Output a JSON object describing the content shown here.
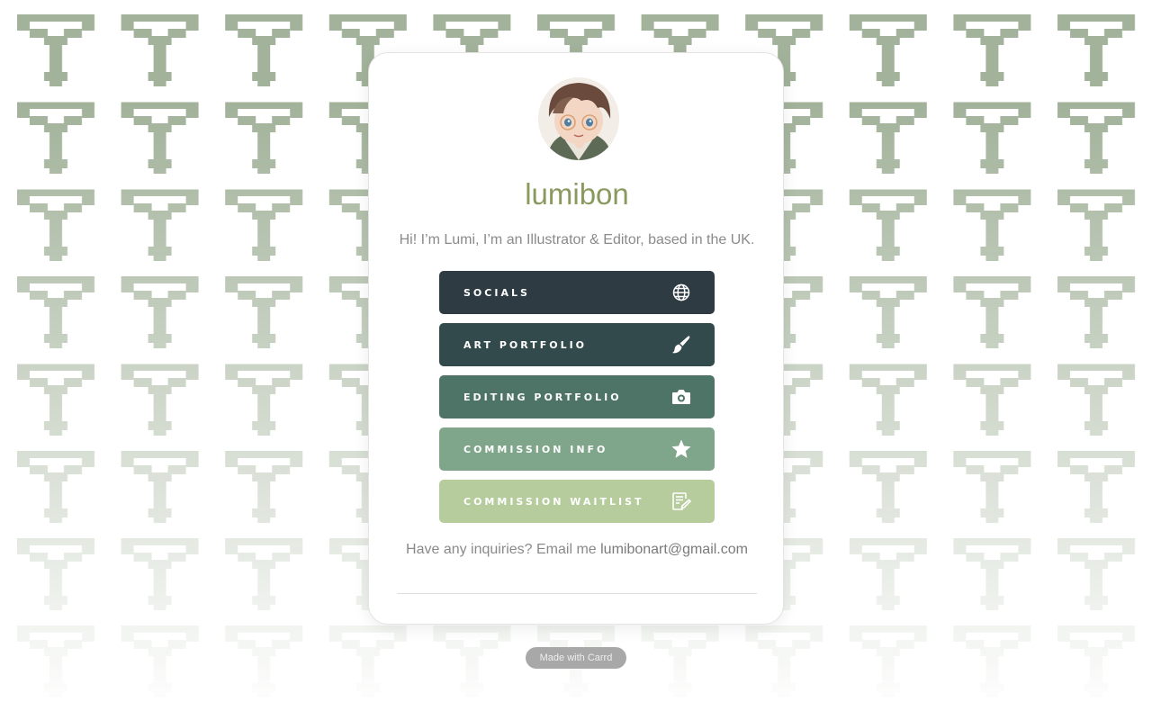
{
  "profile": {
    "name": "lumibon",
    "bio": "Hi! I’m Lumi, I’m an Illustrator & Editor, based in the UK."
  },
  "buttons": [
    {
      "label": "SOCIALS",
      "icon": "globe-icon",
      "color": "#2e3b43"
    },
    {
      "label": "ART PORTFOLIO",
      "icon": "paintbrush-icon",
      "color": "#334a4d"
    },
    {
      "label": "EDITING PORTFOLIO",
      "icon": "camera-icon",
      "color": "#4e7468"
    },
    {
      "label": "COMMISSION INFO",
      "icon": "star-icon",
      "color": "#7fa58a"
    },
    {
      "label": "COMMISSION WAITLIST",
      "icon": "edit-note-icon",
      "color": "#b6cc9c"
    }
  ],
  "contact": {
    "text": "Have any inquiries? Email me",
    "email": "lumibonart@gmail.com"
  },
  "footer": {
    "badge": "Made with Carrd"
  },
  "colors": {
    "accent": "#8a9a5e",
    "pattern": "#a3b39b"
  }
}
